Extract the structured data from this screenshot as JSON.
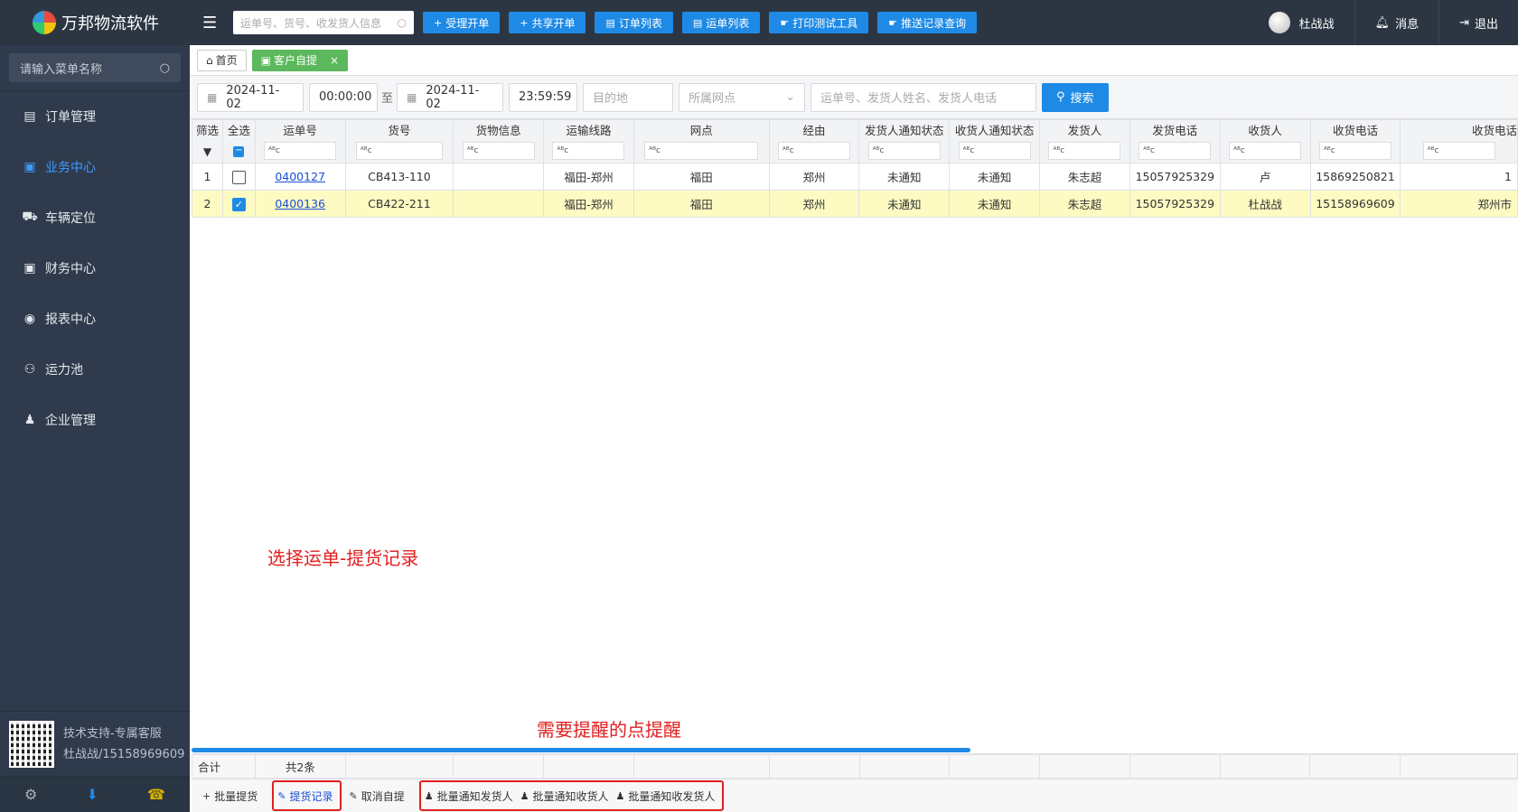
{
  "app": {
    "title": "万邦物流软件"
  },
  "top": {
    "search_placeholder": "运单号、货号、收发货人信息",
    "buttons": [
      {
        "label": "受理开单",
        "icon": "plus-icon",
        "glyph": "+"
      },
      {
        "label": "共享开单",
        "icon": "plus-icon",
        "glyph": "+"
      },
      {
        "label": "订单列表",
        "icon": "list-icon",
        "glyph": "▤"
      },
      {
        "label": "运单列表",
        "icon": "list-icon",
        "glyph": "▤"
      },
      {
        "label": "打印测试工具",
        "icon": "thumb-icon",
        "glyph": "☛"
      },
      {
        "label": "推送记录查询",
        "icon": "thumb-icon",
        "glyph": "☛"
      }
    ],
    "user": "杜战战",
    "messages": "消息",
    "logout": "退出"
  },
  "sidebar": {
    "search_placeholder": "请输入菜单名称",
    "items": [
      {
        "label": "订单管理",
        "glyph": "▤",
        "name": "sidebar-item-orders",
        "icon": "document-icon"
      },
      {
        "label": "业务中心",
        "glyph": "▣",
        "name": "sidebar-item-business",
        "icon": "business-icon",
        "active": true
      },
      {
        "label": "车辆定位",
        "glyph": "⛟",
        "name": "sidebar-item-vehicle",
        "icon": "truck-icon"
      },
      {
        "label": "财务中心",
        "glyph": "▣",
        "name": "sidebar-item-finance",
        "icon": "money-icon"
      },
      {
        "label": "报表中心",
        "glyph": "◉",
        "name": "sidebar-item-reports",
        "icon": "eye-icon"
      },
      {
        "label": "运力池",
        "glyph": "⚇",
        "name": "sidebar-item-capacity",
        "icon": "network-icon"
      },
      {
        "label": "企业管理",
        "glyph": "♟",
        "name": "sidebar-item-enterprise",
        "icon": "user-lock-icon"
      }
    ],
    "support_line1": "技术支持-专属客服",
    "support_line2": "杜战战/15158969609"
  },
  "tabs": [
    {
      "label": "首页",
      "glyph": "⌂"
    },
    {
      "label": "客户自提",
      "glyph": "▣",
      "close": "×"
    }
  ],
  "filter": {
    "date_from": "2024-11-02",
    "time_from": "00:00:00",
    "to_label": "至",
    "date_to": "2024-11-02",
    "time_to": "23:59:59",
    "destination_placeholder": "目的地",
    "branch_placeholder": "所属网点",
    "keyword_placeholder": "运单号、发货人姓名、发货人电话",
    "search_label": "搜索"
  },
  "table": {
    "columns": [
      "筛选",
      "全选",
      "运单号",
      "货号",
      "货物信息",
      "运输线路",
      "网点",
      "经由",
      "发货人通知状态",
      "收货人通知状态",
      "发货人",
      "发货电话",
      "收货人",
      "收货电话",
      "收货电话"
    ],
    "filter_glyph": "ᴬᴮc",
    "rows": [
      {
        "no": "1",
        "checked": false,
        "waybill": "0400127",
        "cargo_no": "CB413-110",
        "cargo_info": "",
        "route": "福田-郑州",
        "branch": "福田",
        "via": "郑州",
        "sender_status": "未通知",
        "receiver_status": "未通知",
        "sender": "朱志超",
        "sender_phone": "15057925329",
        "receiver": "卢",
        "receiver_phone": "15869250821",
        "extra": "1"
      },
      {
        "no": "2",
        "checked": true,
        "waybill": "0400136",
        "cargo_no": "CB422-211",
        "cargo_info": "",
        "route": "福田-郑州",
        "branch": "福田",
        "via": "郑州",
        "sender_status": "未通知",
        "receiver_status": "未通知",
        "sender": "朱志超",
        "sender_phone": "15057925329",
        "receiver": "杜战战",
        "receiver_phone": "15158969609",
        "extra": "郑州市"
      }
    ],
    "total_label": "合计",
    "total_count": "共2条"
  },
  "annotations": {
    "a1": "选择运单-提货记录",
    "a2": "需要提醒的点提醒"
  },
  "actions": {
    "batch_pickup": "批量提货",
    "pickup_record": "提货记录",
    "cancel_pickup": "取消自提",
    "notify_sender": "批量通知发货人",
    "notify_receiver": "批量通知收货人",
    "notify_both": "批量通知收发货人"
  },
  "colors": {
    "accent": "#1e8ae6",
    "topbar": "#2c3643",
    "sidebar": "#2f3b4c",
    "selected_row": "#fdfbc2",
    "annotation": "#e01f1f"
  }
}
